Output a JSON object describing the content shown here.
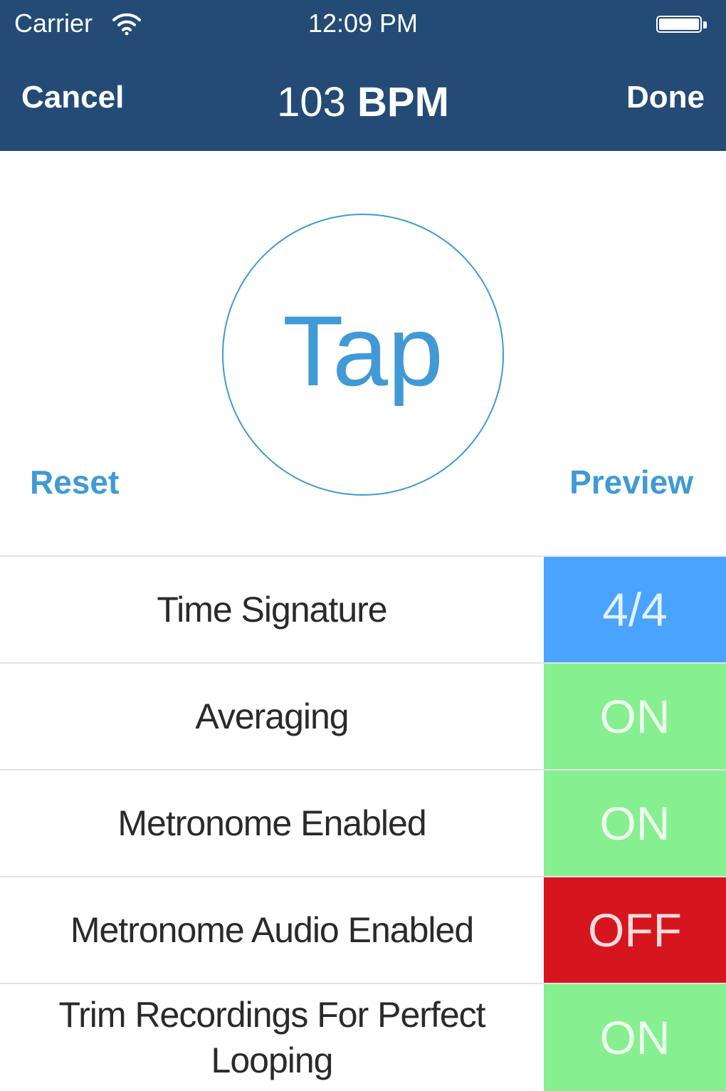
{
  "status_bar": {
    "carrier": "Carrier",
    "time": "12:09 PM"
  },
  "nav": {
    "cancel_label": "Cancel",
    "title_value": "103",
    "title_unit": "BPM",
    "done_label": "Done"
  },
  "tap": {
    "label": "Tap",
    "accent": "#3f9ad6"
  },
  "actions": {
    "reset_label": "Reset",
    "preview_label": "Preview"
  },
  "settings": [
    {
      "label": "Time Signature",
      "value": "4/4",
      "color": "#4aa3ff"
    },
    {
      "label": "Averaging",
      "value": "ON",
      "color": "#86ef8f"
    },
    {
      "label": "Metronome Enabled",
      "value": "ON",
      "color": "#86ef8f"
    },
    {
      "label": "Metronome Audio Enabled",
      "value": "OFF",
      "color": "#d7151f"
    },
    {
      "label": "Trim Recordings For Perfect Looping",
      "value": "ON",
      "color": "#86ef8f"
    }
  ],
  "colors": {
    "nav_background": "#234b75"
  }
}
